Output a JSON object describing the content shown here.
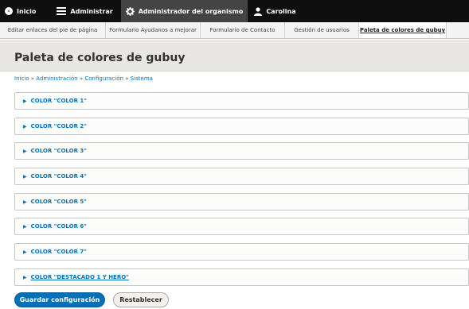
{
  "toolbar": {
    "home_label": "Inicio",
    "admin_label": "Administrar",
    "org_admin_label": "Administrador del organismo",
    "user_label": "Carolina"
  },
  "tray": {
    "items": [
      {
        "label": "Editar enlaces del pie de página"
      },
      {
        "label": "Formulario Ayudanos a mejorar"
      },
      {
        "label": "Formulario de Contacto"
      },
      {
        "label": "Gestión de usuarios"
      },
      {
        "label": "Paleta de colores de gubuy"
      }
    ]
  },
  "page": {
    "title": "Paleta de colores de gubuy"
  },
  "breadcrumb": {
    "items": [
      "Inicio",
      "Administración",
      "Configuración",
      "Sistema"
    ],
    "separator": "»"
  },
  "sections": [
    {
      "label": "COLOR \"COLOR 1\""
    },
    {
      "label": "COLOR \"COLOR 2\""
    },
    {
      "label": "COLOR \"COLOR 3\""
    },
    {
      "label": "COLOR \"COLOR 4\""
    },
    {
      "label": "COLOR \"COLOR 5\""
    },
    {
      "label": "COLOR \"COLOR 6\""
    },
    {
      "label": "COLOR \"COLOR 7\""
    },
    {
      "label": "COLOR \"DESTACADO 1 Y HERO\""
    }
  ],
  "actions": {
    "save_label": "Guardar configuración",
    "reset_label": "Restablecer"
  },
  "colors": {
    "toolbar_bg": "#0f0f0f",
    "link_blue": "#0074bd",
    "primary_button": "#0071b8"
  }
}
